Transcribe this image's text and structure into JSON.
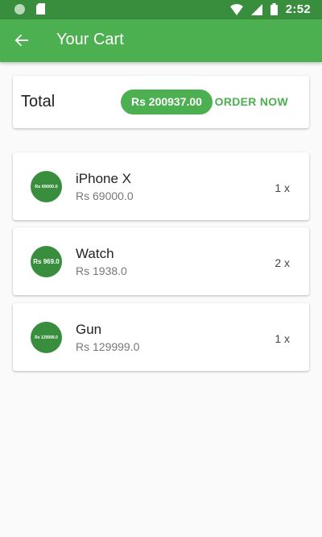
{
  "status_bar": {
    "time": "2:52"
  },
  "app_bar": {
    "title": "Your Cart"
  },
  "summary": {
    "label": "Total",
    "amount": "Rs 200937.00",
    "order_button": "ORDER NOW"
  },
  "items": [
    {
      "avatar_text": "Rs 69000.0",
      "name": "iPhone X",
      "price": "Rs 69000.0",
      "qty": "1 x"
    },
    {
      "avatar_text": "Rs 969.0",
      "name": "Watch",
      "price": "Rs 1938.0",
      "qty": "2 x"
    },
    {
      "avatar_text": "Rs 129999.0",
      "name": "Gun",
      "price": "Rs 129999.0",
      "qty": "1 x"
    }
  ],
  "colors": {
    "primary": "#4caf50",
    "primary_dark": "#388e3c",
    "background": "#fafafa"
  }
}
